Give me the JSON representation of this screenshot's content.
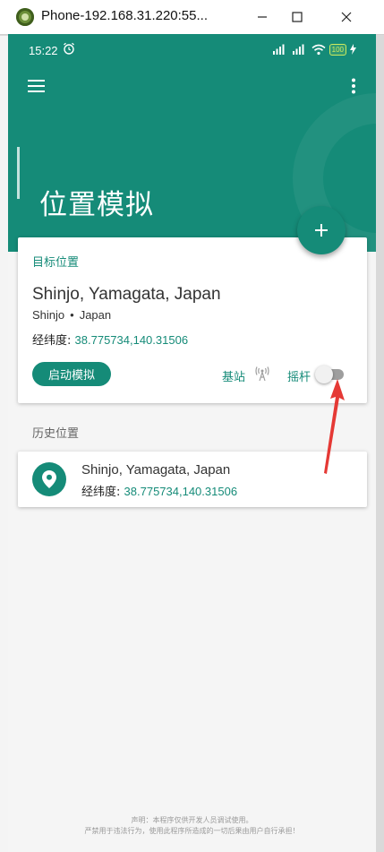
{
  "window": {
    "title": "Phone-192.168.31.220:55..."
  },
  "status_bar": {
    "time": "15:22",
    "battery": "100"
  },
  "header": {
    "title": "位置模拟"
  },
  "target_card": {
    "section_label": "目标位置",
    "place_name": "Shinjo, Yamagata, Japan",
    "city": "Shinjo",
    "country": "Japan",
    "coord_label": "经纬度:",
    "coord_value": "38.775734,140.31506",
    "start_button": "启动模拟",
    "base_station_label": "基站",
    "joystick_label": "摇杆",
    "joystick_enabled": false
  },
  "history": {
    "section_label": "历史位置",
    "items": [
      {
        "name": "Shinjo, Yamagata, Japan",
        "coord_label": "经纬度:",
        "coord_value": "38.775734,140.31506"
      }
    ]
  },
  "disclaimer": {
    "line1": "声明：本程序仅供开发人员调试使用。",
    "line2": "严禁用于违法行为，使用此程序所造成的一切后果由用户自行承担！"
  },
  "colors": {
    "primary": "#158b78",
    "annotation_arrow": "#e53935"
  },
  "icons": [
    "android-app-icon",
    "minimize-icon",
    "maximize-icon",
    "close-icon",
    "alarm-icon",
    "signal-icon",
    "wifi-icon",
    "menu-icon",
    "more-vert-icon",
    "add-icon",
    "cell-tower-icon",
    "location-pin-icon"
  ]
}
